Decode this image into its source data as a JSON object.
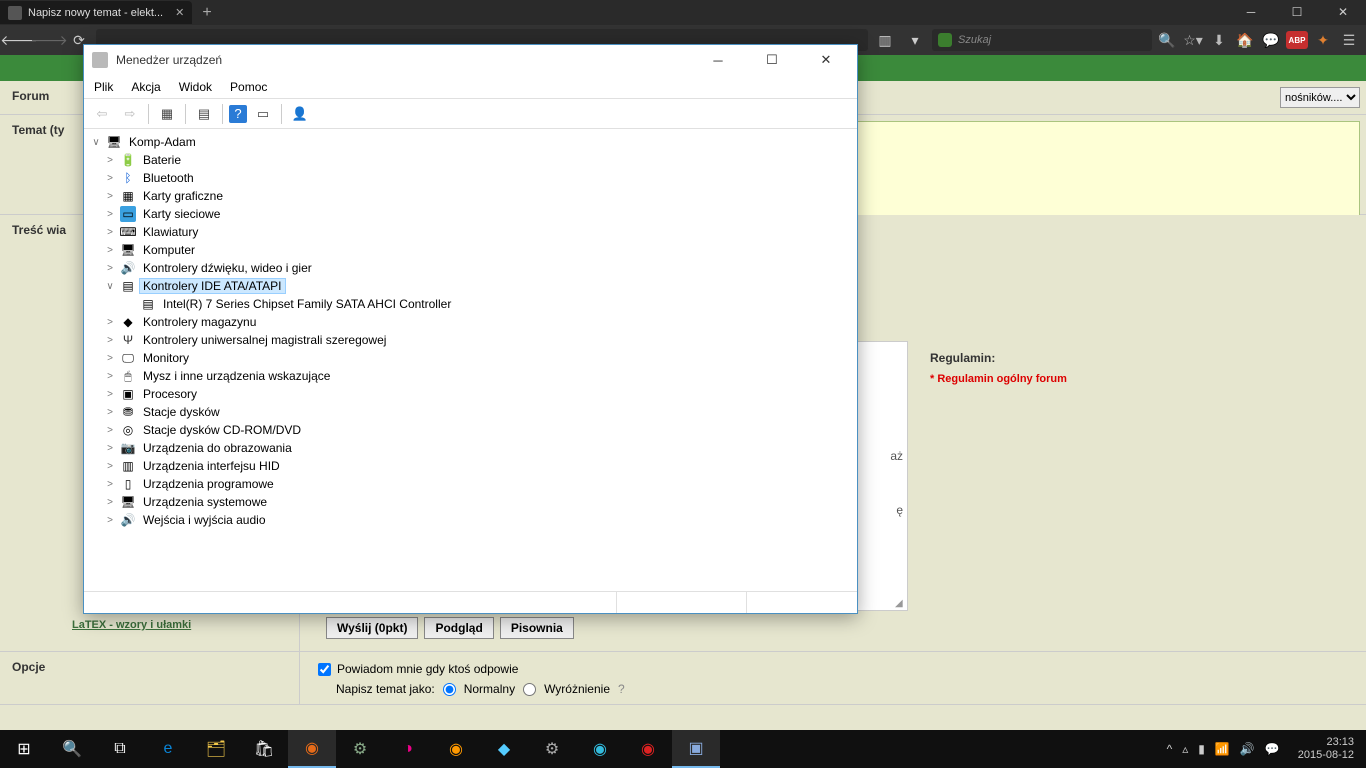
{
  "browser": {
    "tab_title": "Napisz nowy temat - elekt...",
    "tab_add": "+",
    "search_placeholder": "Szukaj",
    "abp": "ABP"
  },
  "forum": {
    "labels": {
      "forum": "Forum",
      "temat": "Temat (ty",
      "tresc": "Treść wia",
      "opcje": "Opcje"
    },
    "select_text": "nośników....",
    "latex": "LaTEX - wzory i ułamki",
    "buttons": {
      "send": "Wyślij (0pkt)",
      "preview": "Podgląd",
      "spell": "Pisownia"
    },
    "opt_notify": "Powiadom mnie gdy ktoś odpowie",
    "opt_write_as": "Napisz temat jako:",
    "opt_normal": "Normalny",
    "opt_highlight": "Wyróżnienie",
    "side_truncated1": "aż",
    "side_truncated2": "ę",
    "reg_title": "Regulamin:",
    "reg_link": "* Regulamin ogólny forum"
  },
  "devmgr": {
    "title": "Menedżer urządzeń",
    "menu": {
      "file": "Plik",
      "action": "Akcja",
      "view": "Widok",
      "help": "Pomoc"
    },
    "tree": {
      "root": "Komp-Adam",
      "items": [
        {
          "l": "Baterie",
          "i": "🔋"
        },
        {
          "l": "Bluetooth",
          "i": "ᛒ",
          "cls": "ic-bt"
        },
        {
          "l": "Karty graficzne",
          "i": "▦"
        },
        {
          "l": "Karty sieciowe",
          "i": "▭",
          "cls": "ic-net"
        },
        {
          "l": "Klawiatury",
          "i": "⌨"
        },
        {
          "l": "Komputer",
          "i": "🖥"
        },
        {
          "l": "Kontrolery dźwięku, wideo i gier",
          "i": "🔊",
          "cls": "ic-spk"
        },
        {
          "l": "Kontrolery IDE ATA/ATAPI",
          "i": "▤",
          "sel": true,
          "expanded": true
        },
        {
          "l": "Kontrolery magazynu",
          "i": "◆"
        },
        {
          "l": "Kontrolery uniwersalnej magistrali szeregowej",
          "i": "Ψ",
          "cls": "ic-usb"
        },
        {
          "l": "Monitory",
          "i": "🖵"
        },
        {
          "l": "Mysz i inne urządzenia wskazujące",
          "i": "🖱",
          "cls": "ic-mouse"
        },
        {
          "l": "Procesory",
          "i": "▣"
        },
        {
          "l": "Stacje dysków",
          "i": "⛃"
        },
        {
          "l": "Stacje dysków CD-ROM/DVD",
          "i": "◎"
        },
        {
          "l": "Urządzenia do obrazowania",
          "i": "📷"
        },
        {
          "l": "Urządzenia interfejsu HID",
          "i": "▥"
        },
        {
          "l": "Urządzenia programowe",
          "i": "▯"
        },
        {
          "l": "Urządzenia systemowe",
          "i": "🖥"
        },
        {
          "l": "Wejścia i wyjścia audio",
          "i": "🔊",
          "cls": "ic-spk"
        }
      ],
      "child": "Intel(R) 7 Series Chipset Family SATA AHCI Controller"
    }
  },
  "taskbar": {
    "time": "23:13",
    "date": "2015-08-12"
  }
}
